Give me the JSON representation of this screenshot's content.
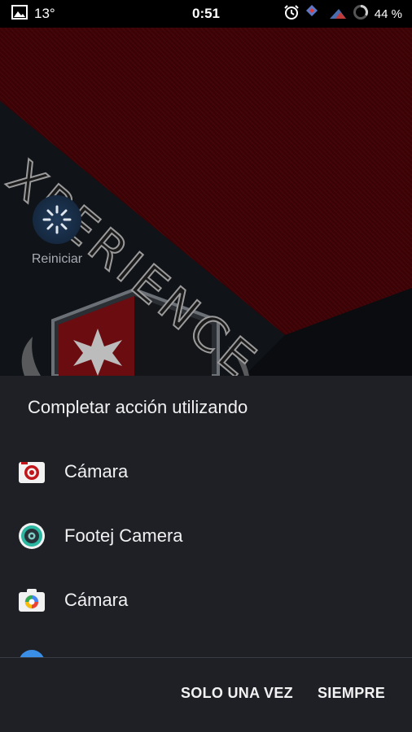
{
  "status_bar": {
    "temperature": "13°",
    "time": "0:51",
    "battery": "44 %"
  },
  "wallpaper": {
    "brand_text": "XPERIENCE"
  },
  "home_shortcut": {
    "label": "Reiniciar"
  },
  "chooser": {
    "title": "Completar acción utilizando",
    "apps": [
      {
        "label": "Cámara",
        "icon": "camera-red-icon"
      },
      {
        "label": "Footej Camera",
        "icon": "footej-camera-icon"
      },
      {
        "label": "Cámara",
        "icon": "camera-blue-icon"
      },
      {
        "label": "",
        "icon": "partial-app-icon"
      }
    ],
    "buttons": {
      "once": "SOLO UNA VEZ",
      "always": "SIEMPRE"
    }
  },
  "colors": {
    "sheet_background": "#1e2026",
    "accent_red": "#c0161b",
    "footej_teal": "#2bb6a1"
  }
}
